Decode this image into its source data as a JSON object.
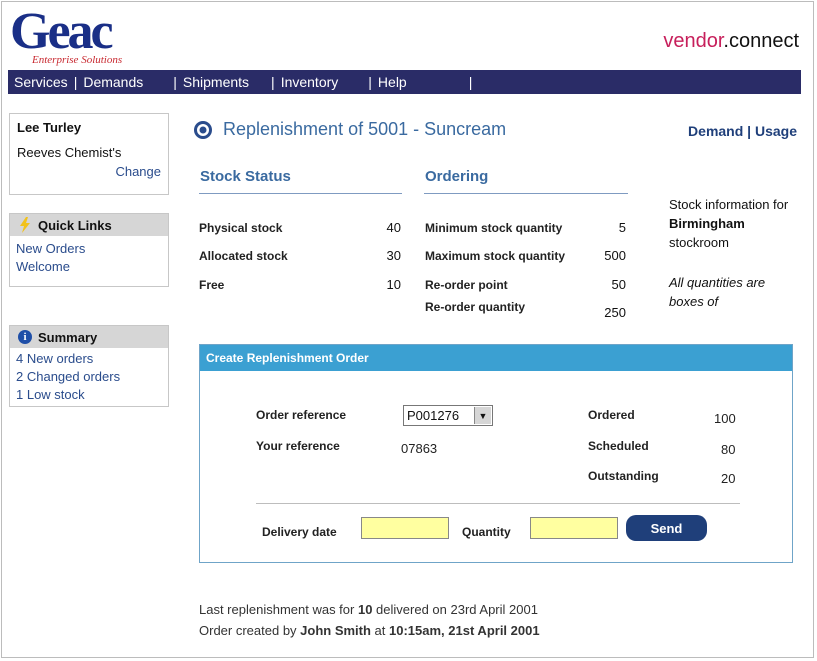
{
  "brand": {
    "logo": "Geac",
    "logo_sub": "Enterprise Solutions",
    "product_a": "vendor",
    "product_b": ".connect"
  },
  "nav": [
    "Services",
    "Demands",
    "Shipments",
    "Inventory",
    "Help"
  ],
  "user": {
    "name": "Lee Turley",
    "store": "Reeves Chemist's",
    "change": "Change"
  },
  "quick_links": {
    "title": "Quick Links",
    "items": [
      "New Orders",
      "Welcome"
    ]
  },
  "summary": {
    "title": "Summary",
    "items": [
      "4 New orders",
      "2 Changed orders",
      "1 Low stock"
    ]
  },
  "page": {
    "title": "Replenishment of 5001 - Suncream",
    "links": "Demand | Usage"
  },
  "stock_status": {
    "title": "Stock Status",
    "rows": [
      {
        "label": "Physical stock",
        "value": "40"
      },
      {
        "label": "Allocated stock",
        "value": "30"
      },
      {
        "label": "Free",
        "value": "10"
      }
    ]
  },
  "ordering": {
    "title": "Ordering",
    "rows": [
      {
        "label": "Minimum stock quantity",
        "value": "5"
      },
      {
        "label": "Maximum stock quantity",
        "value": "500"
      },
      {
        "label": "Re-order point",
        "value": "50"
      },
      {
        "label": "Re-order quantity",
        "value": "250"
      }
    ]
  },
  "side_info": {
    "prefix": "Stock information for ",
    "place": "Birmingham",
    "suffix": " stockroom",
    "note": "All quantities are boxes of"
  },
  "order": {
    "header": "Create Replenishment Order",
    "order_ref_label": "Order reference",
    "order_ref_value": "P001276",
    "your_ref_label": "Your reference",
    "your_ref_value": "07863",
    "ordered_label": "Ordered",
    "ordered_value": "100",
    "scheduled_label": "Scheduled",
    "scheduled_value": "80",
    "outstanding_label": "Outstanding",
    "outstanding_value": "20",
    "delivery_label": "Delivery date",
    "quantity_label": "Quantity",
    "send_label": "Send"
  },
  "footer": {
    "line1_a": "Last replenishment was for ",
    "line1_b": "10",
    "line1_c": " delivered on 23rd April 2001",
    "line2_a": "Order created by ",
    "line2_b": "John Smith",
    "line2_c": " at ",
    "line2_d": "10:15am, 21st April 2001"
  },
  "colors": {
    "nav": "#2a2c67",
    "accent": "#3ba0d2",
    "input_bg": "#ffffa0",
    "button": "#1f3f7a"
  }
}
